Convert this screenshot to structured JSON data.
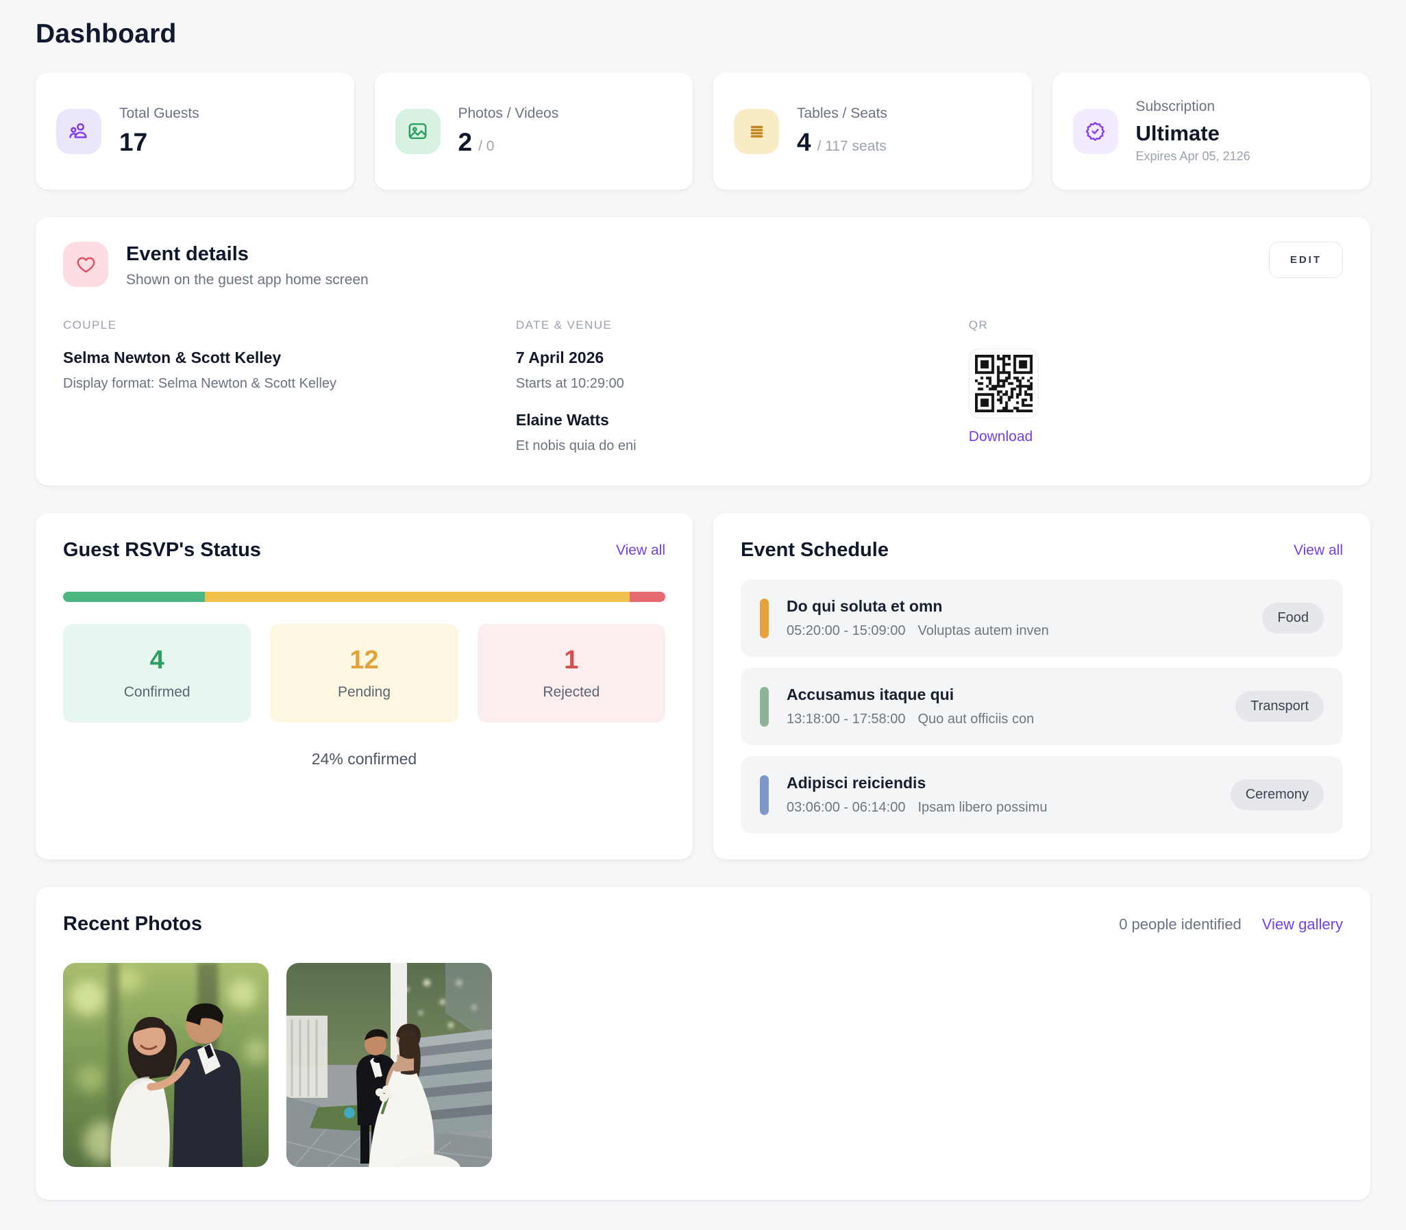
{
  "page": {
    "title": "Dashboard"
  },
  "colors": {
    "accent": "#7440e0",
    "page_background": "#f7f7f9"
  },
  "stats": [
    {
      "label": "Total Guests",
      "value": "17",
      "suffix": "",
      "icon": "users-icon",
      "icon_color": "#7c3aed",
      "icon_bg": "#ece6fc"
    },
    {
      "label": "Photos / Videos",
      "value": "2",
      "suffix": "/ 0",
      "icon": "image-icon",
      "icon_color": "#2f9e63",
      "icon_bg": "#d8f2e2"
    },
    {
      "label": "Tables / Seats",
      "value": "4",
      "suffix": "/ 117 seats",
      "icon": "rows-icon",
      "icon_color": "#c4841d",
      "icon_bg": "#f9ecc5"
    },
    {
      "label": "Subscription",
      "value": "Ultimate",
      "suffix": "",
      "note": "Expires Apr 05, 2126",
      "icon": "badge-check-icon",
      "icon_color": "#8b3fe8",
      "icon_bg": "#f2eafd"
    }
  ],
  "event_details": {
    "title": "Event details",
    "subtitle": "Shown on the guest app home screen",
    "edit_label": "EDIT",
    "icon_color": "#e04f63",
    "icon_bg": "#fbdde2",
    "couple": {
      "heading": "COUPLE",
      "names": "Selma Newton & Scott Kelley",
      "display_format": "Display format: Selma Newton & Scott Kelley"
    },
    "date_venue": {
      "heading": "DATE & VENUE",
      "date": "7 April 2026",
      "starts": "Starts at 10:29:00",
      "venue": "Elaine Watts",
      "venue_note": "Et nobis quia do eni"
    },
    "qr": {
      "heading": "QR",
      "download_label": "Download"
    }
  },
  "rsvp": {
    "title": "Guest RSVP's Status",
    "view_all_label": "View all",
    "summary": "24% confirmed",
    "tiles": [
      {
        "label": "Confirmed",
        "count": 4,
        "color": "#2f9e63",
        "bg": "#e7f6ee",
        "bar_color": "#4cb782"
      },
      {
        "label": "Pending",
        "count": 12,
        "color": "#e2a23b",
        "bg": "#fdf6e1",
        "bar_color": "#f0c14b"
      },
      {
        "label": "Rejected",
        "count": 1,
        "color": "#d4504e",
        "bg": "#fcedee",
        "bar_color": "#e56a72"
      }
    ]
  },
  "schedule": {
    "title": "Event Schedule",
    "view_all_label": "View all",
    "items": [
      {
        "title": "Do qui soluta et omn",
        "time": "05:20:00 - 15:09:00",
        "desc": "Voluptas autem inven",
        "tag": "Food",
        "bar_color": "#e9a13b"
      },
      {
        "title": "Accusamus itaque qui",
        "time": "13:18:00 - 17:58:00",
        "desc": "Quo aut officiis con",
        "tag": "Transport",
        "bar_color": "#8fb39a"
      },
      {
        "title": "Adipisci reiciendis",
        "time": "03:06:00 - 06:14:00",
        "desc": "Ipsam libero possimu",
        "tag": "Ceremony",
        "bar_color": "#7d98c8"
      }
    ]
  },
  "photos": {
    "title": "Recent Photos",
    "people_identified_label": "0 people identified",
    "view_gallery_label": "View gallery"
  }
}
